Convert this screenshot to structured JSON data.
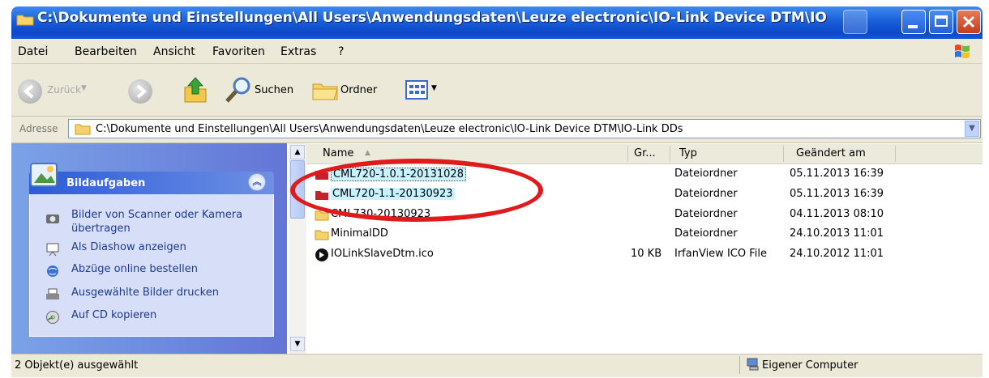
{
  "window": {
    "title": "C:\\Dokumente und Einstellungen\\All Users\\Anwendungsdaten\\Leuze electronic\\IO-Link Device DTM\\IO"
  },
  "menu": [
    "Datei",
    "Bearbeiten",
    "Ansicht",
    "Favoriten",
    "Extras",
    "?"
  ],
  "toolbar": {
    "back_label": "Zurück",
    "search_label": "Suchen",
    "folders_label": "Ordner"
  },
  "address": {
    "label": "Adresse",
    "value": "C:\\Dokumente und Einstellungen\\All Users\\Anwendungsdaten\\Leuze electronic\\IO-Link Device DTM\\IO-Link DDs"
  },
  "taskpane": {
    "header": "Bildaufgaben",
    "items": [
      {
        "label": "Bilder von Scanner oder Kamera",
        "label2": "übertragen",
        "icon": "camera-icon"
      },
      {
        "label": "Als Diashow anzeigen",
        "icon": "slideshow-icon"
      },
      {
        "label": "Abzüge online bestellen",
        "icon": "globe-icon"
      },
      {
        "label": "Ausgewählte Bilder drucken",
        "icon": "printer-icon"
      },
      {
        "label": "Auf CD kopieren",
        "icon": "cd-icon"
      }
    ]
  },
  "columns": {
    "name": "Name",
    "size": "Gr...",
    "type": "Typ",
    "modified": "Geändert am"
  },
  "files": [
    {
      "name": "CML720-1.0.1-20131028",
      "size": "",
      "type": "Dateiordner",
      "modified": "05.11.2013 16:39",
      "icon": "folder-icon",
      "selected": true
    },
    {
      "name": "CML720-1.1-20130923",
      "size": "",
      "type": "Dateiordner",
      "modified": "05.11.2013 16:39",
      "icon": "folder-icon",
      "selected": true
    },
    {
      "name": "CML730-20130923",
      "size": "",
      "type": "Dateiordner",
      "modified": "04.11.2013 08:10",
      "icon": "folder-icon",
      "selected": false
    },
    {
      "name": "MinimalDD",
      "size": "",
      "type": "Dateiordner",
      "modified": "24.10.2013 11:01",
      "icon": "folder-icon",
      "selected": false
    },
    {
      "name": "IOLinkSlaveDtm.ico",
      "size": "10 KB",
      "type": "IrfanView ICO File",
      "modified": "24.10.2012 11:01",
      "icon": "ico-file-icon",
      "selected": false
    }
  ],
  "status": {
    "left": "2 Objekt(e) ausgewählt",
    "right": "Eigener Computer"
  },
  "colors": {
    "titlebar": "#1a5fd9",
    "selection": "#c6f3ff",
    "highlight": "#e01b1b"
  }
}
